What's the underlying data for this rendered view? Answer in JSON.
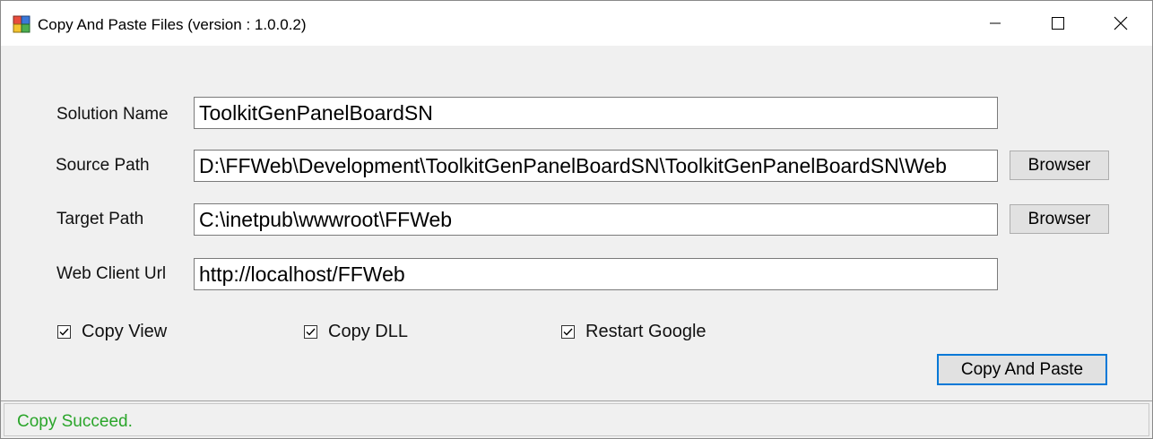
{
  "window": {
    "title": "Copy And Paste Files (version : 1.0.0.2)",
    "icon": "app-icon"
  },
  "form": {
    "solution_name": {
      "label": "Solution Name",
      "value": "ToolkitGenPanelBoardSN"
    },
    "source_path": {
      "label": "Source Path",
      "value": "D:\\FFWeb\\Development\\ToolkitGenPanelBoardSN\\ToolkitGenPanelBoardSN\\Web",
      "button": "Browser"
    },
    "target_path": {
      "label": "Target Path",
      "value": "C:\\inetpub\\wwwroot\\FFWeb",
      "button": "Browser"
    },
    "web_client_url": {
      "label": "Web Client Url",
      "value": "http://localhost/FFWeb"
    }
  },
  "options": {
    "copy_view": {
      "label": "Copy View",
      "checked": true
    },
    "copy_dll": {
      "label": "Copy DLL",
      "checked": true
    },
    "restart_google": {
      "label": "Restart Google",
      "checked": true
    }
  },
  "actions": {
    "copy_and_paste": "Copy And Paste"
  },
  "status": {
    "text": "Copy Succeed.",
    "color": "#2aa52a"
  }
}
